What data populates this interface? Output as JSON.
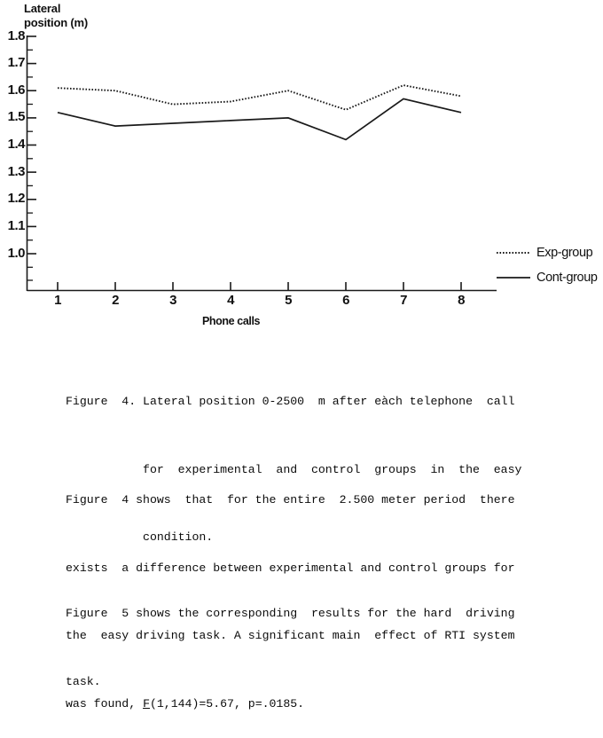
{
  "figure": {
    "y_axis_title": "Lateral\nposition (m)",
    "x_axis_title": "Phone calls",
    "y_ticks": [
      "1.8",
      "1.7",
      "1.6",
      "1.5",
      "1.4",
      "1.3",
      "1.2",
      "1.1",
      "1.0"
    ],
    "x_ticks": [
      "1",
      "2",
      "3",
      "4",
      "5",
      "6",
      "7",
      "8"
    ],
    "legend": {
      "exp_label": "Exp-group",
      "cont_label": "Cont-group"
    }
  },
  "chart_data": {
    "type": "line",
    "title": "",
    "xlabel": "Phone calls",
    "ylabel": "Lateral position (m)",
    "x": [
      1,
      2,
      3,
      4,
      5,
      6,
      7,
      8
    ],
    "categories": [
      "1",
      "2",
      "3",
      "4",
      "5",
      "6",
      "7",
      "8"
    ],
    "xlim": [
      0.6,
      8.6
    ],
    "ylim": [
      0.95,
      1.8
    ],
    "ytick_values": [
      1.8,
      1.7,
      1.6,
      1.5,
      1.4,
      1.3,
      1.2,
      1.1,
      1.0
    ],
    "minor_tick_step": 0.05,
    "grid": false,
    "legend_position": "right",
    "series": [
      {
        "name": "Exp-group",
        "style": "dotted",
        "color": "#1a1a1a",
        "values": [
          1.61,
          1.6,
          1.55,
          1.56,
          1.6,
          1.53,
          1.62,
          1.58
        ]
      },
      {
        "name": "Cont-group",
        "style": "solid",
        "color": "#1a1a1a",
        "values": [
          1.52,
          1.47,
          1.48,
          1.49,
          1.5,
          1.42,
          1.57,
          1.52
        ]
      }
    ]
  },
  "caption": {
    "line_1": "Figure  4. Lateral position 0-2500  m after eàch telephone  call",
    "line_2": "           for  experimental  and  control  groups  in  the  easy",
    "line_3": "           condition."
  },
  "body": {
    "paragraph_1": {
      "line_1": "Figure  4 shows  that  for the entire  2.500 meter period  there",
      "line_2": "exists  a difference between experimental and control groups for",
      "line_3": "the  easy driving task. A significant main  effect of RTI system",
      "line_4_pre": "was found, ",
      "line_4_stat": "F",
      "line_4_post": "(1,144)=5.67, p=.0185."
    },
    "paragraph_2": {
      "line_1": "Figure  5 shows the corresponding  results for the hard  driving",
      "line_2": "task."
    }
  }
}
